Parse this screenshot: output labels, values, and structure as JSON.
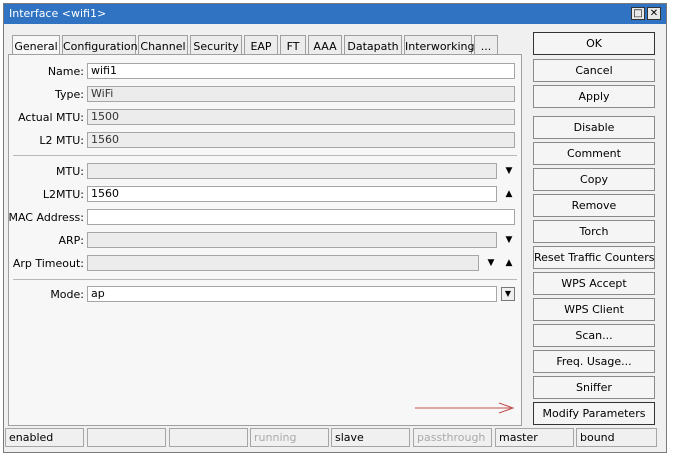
{
  "window": {
    "title": "Interface <wifi1>"
  },
  "titlebar_buttons": {
    "maximize": "□",
    "close": "✕"
  },
  "tabs": [
    {
      "label": "General"
    },
    {
      "label": "Configuration"
    },
    {
      "label": "Channel"
    },
    {
      "label": "Security"
    },
    {
      "label": "EAP"
    },
    {
      "label": "FT"
    },
    {
      "label": "AAA"
    },
    {
      "label": "Datapath"
    },
    {
      "label": "Interworking"
    },
    {
      "label": "..."
    }
  ],
  "form": {
    "name": {
      "label": "Name:",
      "value": "wifi1"
    },
    "type": {
      "label": "Type:",
      "value": "WiFi"
    },
    "actual_mtu": {
      "label": "Actual MTU:",
      "value": "1500"
    },
    "l2mtu_info": {
      "label": "L2 MTU:",
      "value": "1560"
    },
    "mtu": {
      "label": "MTU:",
      "value": ""
    },
    "l2mtu": {
      "label": "L2MTU:",
      "value": "1560"
    },
    "mac_address": {
      "label": "MAC Address:",
      "value": ""
    },
    "arp": {
      "label": "ARP:",
      "value": ""
    },
    "arp_timeout": {
      "label": "Arp Timeout:",
      "value": ""
    },
    "mode": {
      "label": "Mode:",
      "value": "ap"
    }
  },
  "buttons": [
    {
      "label": "OK"
    },
    {
      "label": "Cancel"
    },
    {
      "label": "Apply"
    },
    {
      "label": "Disable"
    },
    {
      "label": "Comment"
    },
    {
      "label": "Copy"
    },
    {
      "label": "Remove"
    },
    {
      "label": "Torch"
    },
    {
      "label": "Reset Traffic Counters"
    },
    {
      "label": "WPS Accept"
    },
    {
      "label": "WPS Client"
    },
    {
      "label": "Scan..."
    },
    {
      "label": "Freq. Usage..."
    },
    {
      "label": "Sniffer"
    },
    {
      "label": "Modify Parameters"
    }
  ],
  "status": [
    "enabled",
    "",
    "",
    "running",
    "slave",
    "passthrough",
    "master",
    "bound"
  ],
  "colors": {
    "titlebar": "#2f73c2",
    "annotation_arrow": "#c0504d"
  }
}
